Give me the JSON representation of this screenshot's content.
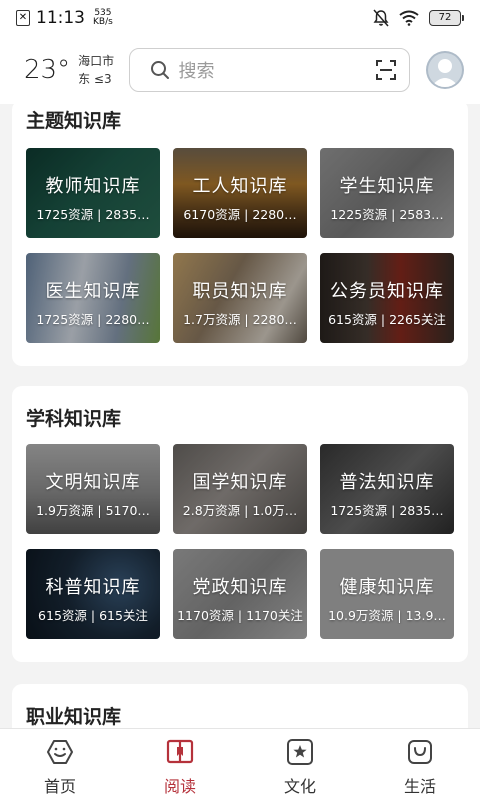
{
  "status_bar": {
    "time": "11:13",
    "speed_value": "535",
    "speed_unit": "KB/s",
    "battery": "72"
  },
  "header": {
    "temperature": "23°",
    "city": "海口市",
    "wind": "东 ≤3",
    "search_placeholder": "搜索"
  },
  "sections": [
    {
      "title": "主题知识库",
      "tiles": [
        {
          "name": "教师知识库",
          "stats": "1725资源 | 2835…"
        },
        {
          "name": "工人知识库",
          "stats": "6170资源 | 2280…"
        },
        {
          "name": "学生知识库",
          "stats": "1225资源 | 2583…"
        },
        {
          "name": "医生知识库",
          "stats": "1725资源 | 2280…"
        },
        {
          "name": "职员知识库",
          "stats": "1.7万资源 | 2280…"
        },
        {
          "name": "公务员知识库",
          "stats": "615资源 | 2265关注"
        }
      ]
    },
    {
      "title": "学科知识库",
      "tiles": [
        {
          "name": "文明知识库",
          "stats": "1.9万资源 | 5170…"
        },
        {
          "name": "国学知识库",
          "stats": "2.8万资源 | 1.0万…"
        },
        {
          "name": "普法知识库",
          "stats": "1725资源 | 2835…"
        },
        {
          "name": "科普知识库",
          "stats": "615资源 | 615关注"
        },
        {
          "name": "党政知识库",
          "stats": "1170资源 | 1170关注"
        },
        {
          "name": "健康知识库",
          "stats": "10.9万资源 | 13.9…"
        }
      ]
    },
    {
      "title": "职业知识库",
      "tiles": []
    }
  ],
  "bottom_nav": [
    {
      "label": "首页",
      "icon": "home-icon"
    },
    {
      "label": "阅读",
      "icon": "book-icon",
      "active": true
    },
    {
      "label": "文化",
      "icon": "star-icon"
    },
    {
      "label": "生活",
      "icon": "bag-icon"
    }
  ],
  "colors": {
    "accent": "#b5323b",
    "background": "#f3f3f3",
    "card": "#ffffff"
  }
}
